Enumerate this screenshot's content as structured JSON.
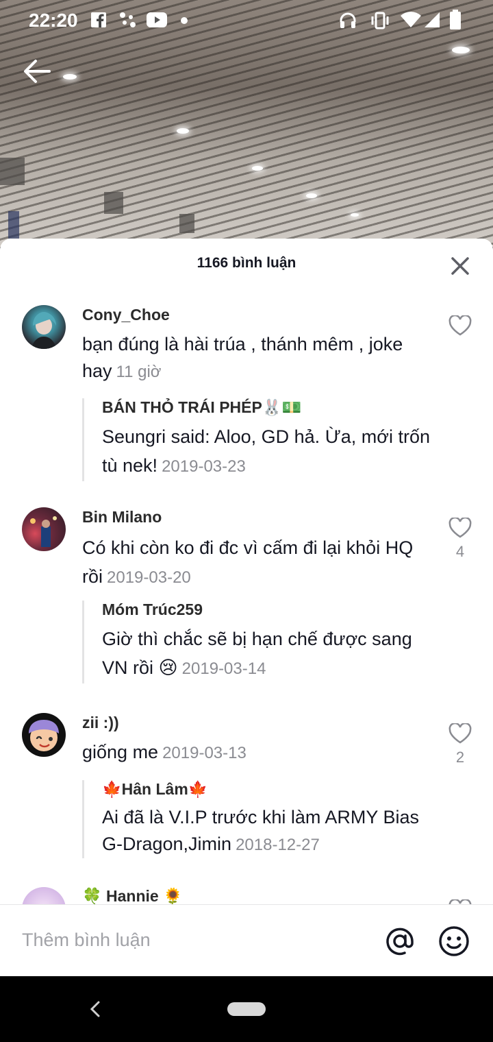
{
  "status_bar": {
    "time": "22:20"
  },
  "sheet": {
    "count_label": "1166 bình luận"
  },
  "comments": [
    {
      "user": "Cony_Choe",
      "text": "bạn đúng là hài trúa , thánh mêm , joke hay",
      "time": "11 giờ",
      "likes": "",
      "reply": {
        "user": "BÁN THỎ TRÁI PHÉP🐰💵",
        "text": "Seungri said: Aloo, GD hả. Ừa, mới trốn tù nek!",
        "time": "2019-03-23"
      }
    },
    {
      "user": "Bin Milano",
      "text": "Có khi còn ko đi đc vì cấm đi lại khỏi HQ rồi",
      "time": "2019-03-20",
      "likes": "4",
      "reply": {
        "user": "Móm Trúc259",
        "text": "Giờ thì chắc sẽ bị hạn chế được sang VN rồi 😢",
        "time": "2019-03-14"
      }
    },
    {
      "user": "zii :))",
      "text": "giống me",
      "time": "2019-03-13",
      "likes": "2",
      "reply": {
        "user": "🍁Hân Lâm🍁",
        "text": "Ai đã là V.I.P trước khi làm ARMY Bias G-Dragon,Jimin",
        "time": "2018-12-27"
      }
    },
    {
      "user": "🍀 Hannie 🌻"
    }
  ],
  "input": {
    "placeholder": "Thêm bình luận"
  },
  "colors": {
    "sheet_bg": "#ffffff",
    "text_primary": "#161823",
    "text_secondary": "#8a8b91",
    "reply_border": "#e3e3e4"
  }
}
